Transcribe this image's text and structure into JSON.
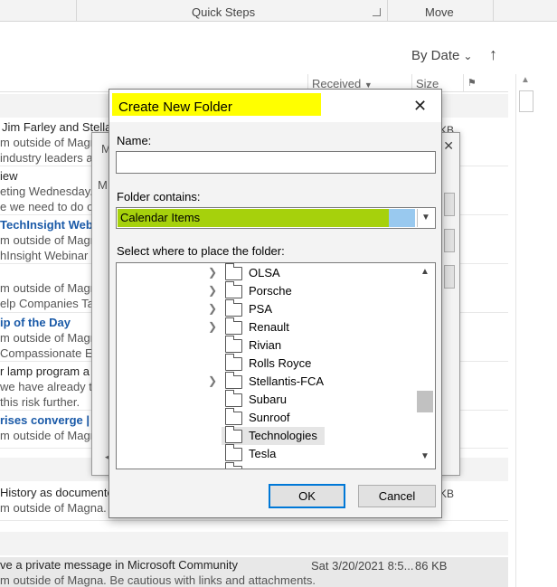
{
  "ribbon": {
    "quick_steps": "Quick Steps",
    "move": "Move"
  },
  "sort": {
    "by_date": "By Date"
  },
  "columns": {
    "received": "Received",
    "size": "Size"
  },
  "mail_items": [
    {
      "line1": "Jim Farley and Stella",
      "line2": "m outside of Magn",
      "line3": "industry leaders a",
      "size": "KB"
    },
    {
      "line1": "iew",
      "line2": "eting Wednesday.",
      "line3": "e we need to do op"
    },
    {
      "line1": "TechInsight Web",
      "line2": "m outside of Magn",
      "line3": "hInsight Webinar"
    },
    {
      "line1": "m outside of Magn",
      "line2": "elp Companies Ta"
    },
    {
      "line1": "ip of the Day",
      "line2": "m outside of Magn",
      "line3": "Compassionate E"
    },
    {
      "line1": "r lamp program a",
      "line2": "we have already t",
      "line3": "this risk further."
    },
    {
      "line1": "rises converge |",
      "line2": "m outside of Magn"
    },
    {
      "line1": "History as documente",
      "line2": "m outside of Magna.",
      "size": "KB"
    },
    {
      "line1": "ve a private message in Microsoft Community",
      "line2": "m outside of Magna. Be cautious with links and attachments.",
      "date": "Sat 3/20/2021 8:5...",
      "size": "86 KB"
    }
  ],
  "bg_dialog": {
    "initial1": "M",
    "initial2": "M"
  },
  "dialog": {
    "title": "Create New Folder",
    "name_label": "Name:",
    "name_value": "",
    "contains_label": "Folder contains:",
    "contains_value": "Calendar Items",
    "place_label": "Select where to place the folder:",
    "folders": [
      {
        "name": "OLSA",
        "expandable": true
      },
      {
        "name": "Porsche",
        "expandable": true
      },
      {
        "name": "PSA",
        "expandable": true
      },
      {
        "name": "Renault",
        "expandable": true
      },
      {
        "name": "Rivian",
        "expandable": false
      },
      {
        "name": "Rolls Royce",
        "expandable": false
      },
      {
        "name": "Stellantis-FCA",
        "expandable": true
      },
      {
        "name": "Subaru",
        "expandable": false
      },
      {
        "name": "Sunroof",
        "expandable": false
      },
      {
        "name": "Technologies",
        "expandable": false,
        "selected": true
      },
      {
        "name": "Tesla",
        "expandable": false
      }
    ],
    "ok": "OK",
    "cancel": "Cancel"
  },
  "colors": {
    "highlight_yellow": "#ffff00",
    "highlight_green": "#a6d10c",
    "selection_blue": "#99c9ef",
    "ok_border": "#0078d7"
  },
  "icons": {
    "close": "close-icon",
    "sort_direction": "arrow-up-icon",
    "expand": "chevron-right-icon",
    "folder": "folder-icon"
  }
}
